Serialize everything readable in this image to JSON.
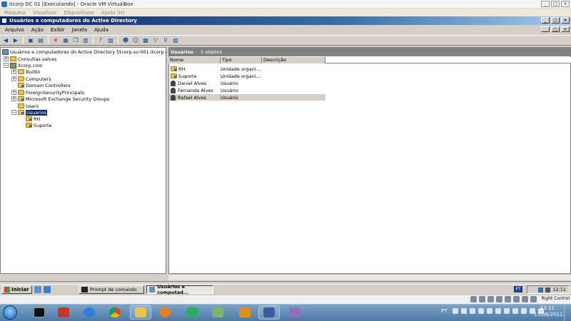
{
  "vbox": {
    "title": "itcorp DC 01 [Executando] - Oracle VM VirtualBox",
    "menu": [
      "Máquina",
      "Visualizar",
      "Dispositivos",
      "Ajuda (H)"
    ],
    "right_control": "Right Control"
  },
  "mmc": {
    "title": "Usuários e computadores do Active Directory",
    "menu": [
      "Arquivo",
      "Ação",
      "Exibir",
      "Janela",
      "Ajuda"
    ]
  },
  "tree": {
    "root": "Usuários e computadores do Active Directory [itcorp-sv-001.itcorp.com]",
    "saved": "Consultas salvas",
    "domain": "itcorp.com",
    "children": [
      "Builtin",
      "Computers",
      "Domain Controllers",
      "ForeignSecurityPrincipals",
      "Microsoft Exchange Security Groups",
      "Users",
      "Usuarios"
    ],
    "usuarios_children": [
      "RH",
      "Suporte"
    ]
  },
  "list": {
    "heading": "Usuarios",
    "count": "5 objetos",
    "columns": [
      "Nome",
      "Tipo",
      "Descrição"
    ],
    "rows": [
      {
        "name": "RH",
        "type": "Unidade organi...",
        "icon": "ou-folder-icon"
      },
      {
        "name": "Suporte",
        "type": "Unidade organi...",
        "icon": "ou-folder-icon"
      },
      {
        "name": "Daniel Alves",
        "type": "Usuário",
        "icon": "user-icon"
      },
      {
        "name": "Fernanda Alves",
        "type": "Usuário",
        "icon": "user-icon"
      },
      {
        "name": "Rafael Alves",
        "type": "Usuário",
        "icon": "user-icon"
      }
    ]
  },
  "guest_taskbar": {
    "start": "Iniciar",
    "tasks": [
      "Prompt de comando",
      "Usuários e computad..."
    ],
    "lang": "PT",
    "clock": "12:11"
  },
  "host": {
    "lang": "PT",
    "time": "12:11",
    "date": "17/08/2011"
  }
}
